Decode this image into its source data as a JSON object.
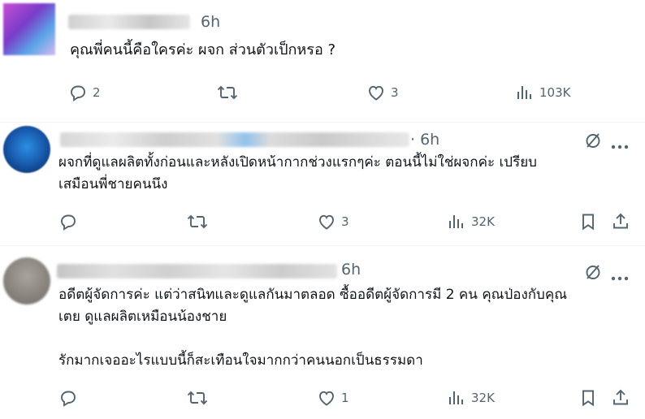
{
  "posts": [
    {
      "time": "6h",
      "text": "คุณพี่คนนี้คือใครค่ะ ผจก ส่วนตัวเป็กหรอ ?",
      "replies": "2",
      "reposts": "",
      "likes": "3",
      "views": "103K"
    },
    {
      "time": "· 6h",
      "text": "ผจกที่ดูแลผลิตทั้งก่อนและหลังเปิดหน้ากากช่วงแรกๆค่ะ ตอนนี้ไม่ใช่ผจกค่ะ  เปรียบ\nเสมือนพี่ชายคนนึง",
      "replies": "",
      "reposts": "",
      "likes": "3",
      "views": "32K"
    },
    {
      "time": "6h",
      "text": "อดีตผู้จัดการค่ะ แต่ว่าสนิทและดูแลกันมาตลอด ซื้ออดีตผู้จัดการมี 2 คน คุณป่องกับคุณ\nเตย ดูแลผลิตเหมือนน้องชาย\n\nรักมากเจออะไรแบบนี้ก็สะเทือนใจมากกว่าคนนอกเป็นธรรมดา",
      "replies": "",
      "reposts": "",
      "likes": "1",
      "views": "32K"
    }
  ],
  "icons": {
    "reply": "reply-icon",
    "repost": "repost-icon",
    "like": "heart-icon",
    "views": "views-icon",
    "bookmark": "bookmark-icon",
    "share": "share-icon",
    "grok": "grok-icon",
    "more": "more-icon"
  },
  "colors": {
    "text": "#0f1419",
    "muted": "#536471",
    "divider": "#eff3f4"
  }
}
